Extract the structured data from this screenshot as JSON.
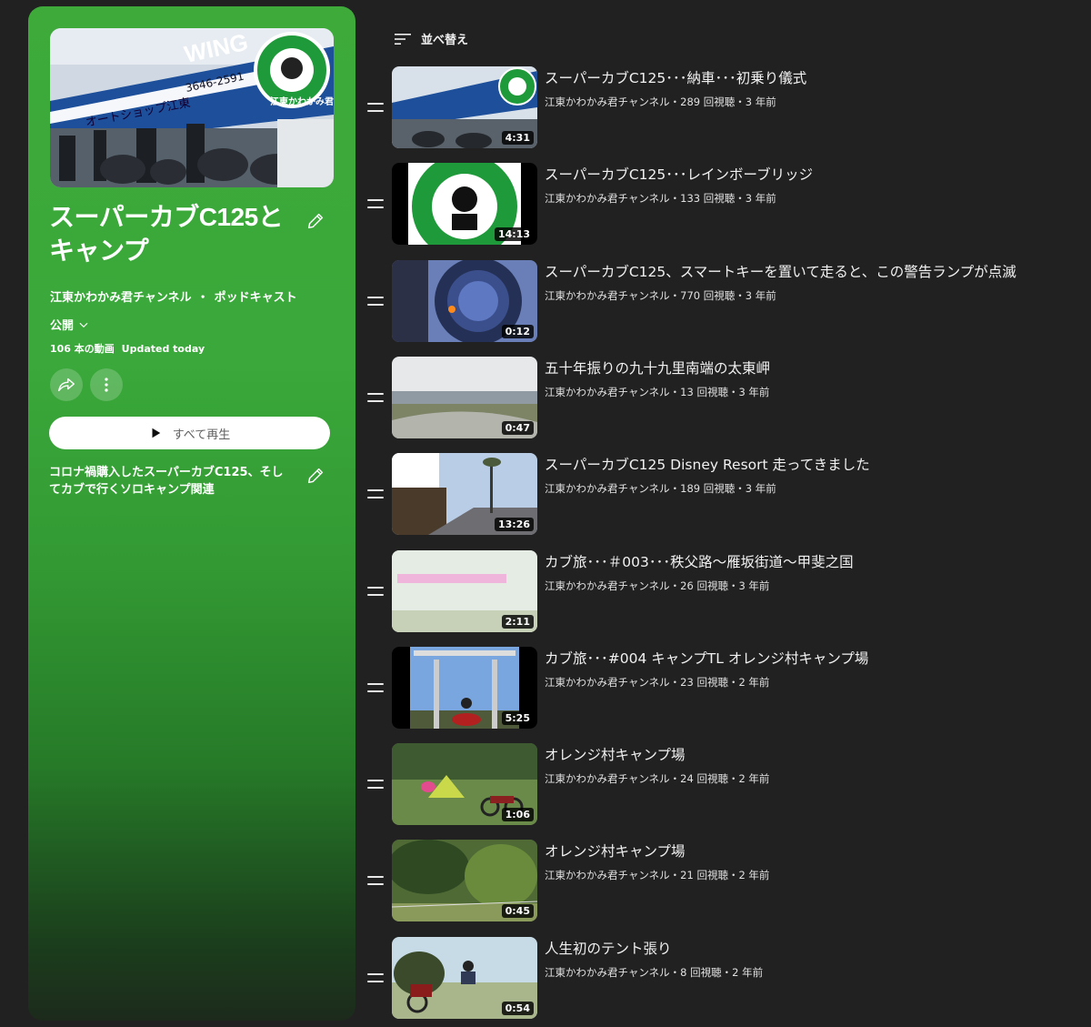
{
  "playlist": {
    "title": "スーパーカブC125とキャンプ",
    "owner": "江東かわかみ君チャンネル",
    "owner_separator": "・",
    "type_label": "ポッドキャスト",
    "privacy": "公開",
    "video_count": "106 本の動画",
    "updated": "Updated today",
    "play_all_label": "すべて再生",
    "description": "コロナ禍購入したスーパーカブC125、そしてカブで行くソロキャンプ関連",
    "thumb_sign": "WING",
    "thumb_shop": "オートショップ江東",
    "thumb_phone": "3646-2591",
    "thumb_logo": "江東かわかみ君",
    "accent_color": "#3aa83a"
  },
  "list": {
    "sort_label": "並べ替え",
    "videos": [
      {
        "title": "スーパーカブC125･･･納車･･･初乗り儀式",
        "meta": "江東かわかみ君チャンネル・289 回視聴・3 年前",
        "duration": "4:31"
      },
      {
        "title": "スーパーカブC125･･･レインボーブリッジ",
        "meta": "江東かわかみ君チャンネル・133 回視聴・3 年前",
        "duration": "14:13"
      },
      {
        "title": "スーパーカブC125、スマートキーを置いて走ると、この警告ランプが点滅",
        "meta": "江東かわかみ君チャンネル・770 回視聴・3 年前",
        "duration": "0:12"
      },
      {
        "title": "五十年振りの九十九里南端の太東岬",
        "meta": "江東かわかみ君チャンネル・13 回視聴・3 年前",
        "duration": "0:47"
      },
      {
        "title": "スーパーカブC125 Disney Resort 走ってきました",
        "meta": "江東かわかみ君チャンネル・189 回視聴・3 年前",
        "duration": "13:26"
      },
      {
        "title": "カブ旅･･･＃003･･･秩父路～雁坂街道～甲斐之国",
        "meta": "江東かわかみ君チャンネル・26 回視聴・3 年前",
        "duration": "2:11"
      },
      {
        "title": "カブ旅･･･#004 キャンプTL オレンジ村キャンプ場",
        "meta": "江東かわかみ君チャンネル・23 回視聴・2 年前",
        "duration": "5:25"
      },
      {
        "title": "オレンジ村キャンプ場",
        "meta": "江東かわかみ君チャンネル・24 回視聴・2 年前",
        "duration": "1:06"
      },
      {
        "title": "オレンジ村キャンプ場",
        "meta": "江東かわかみ君チャンネル・21 回視聴・2 年前",
        "duration": "0:45"
      },
      {
        "title": "人生初のテント張り",
        "meta": "江東かわかみ君チャンネル・8 回視聴・2 年前",
        "duration": "0:54"
      }
    ]
  }
}
